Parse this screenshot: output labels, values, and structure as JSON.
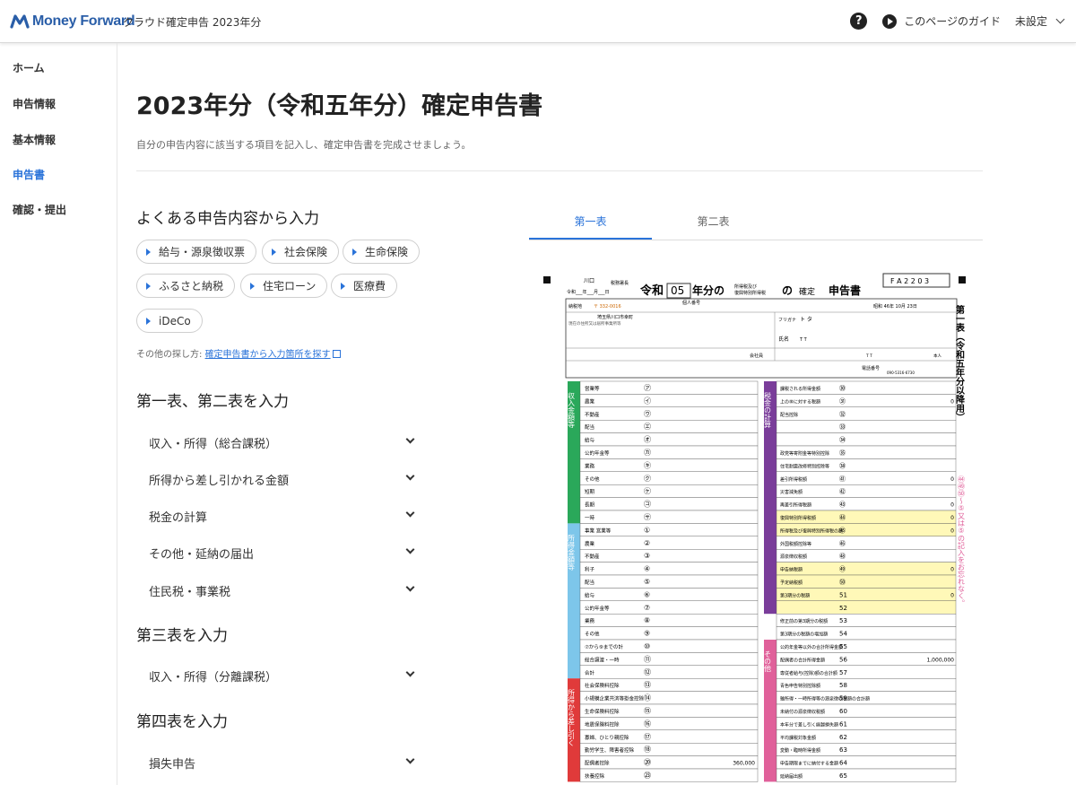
{
  "header": {
    "logo_text": "Money Forward",
    "app_name": "クラウド確定申告 2023年分",
    "help_icon_label": "?",
    "guide_label": "このページのガイド",
    "user_label": "未設定"
  },
  "sidebar": {
    "items": [
      {
        "label": "ホーム"
      },
      {
        "label": "申告情報"
      },
      {
        "label": "基本情報"
      },
      {
        "label": "申告書",
        "active": true
      },
      {
        "label": "確認・提出"
      }
    ]
  },
  "main": {
    "title": "2023年分（令和五年分）確定申告書",
    "subtitle": "自分の申告内容に該当する項目を記入し、確定申告書を完成させましょう。"
  },
  "common": {
    "title": "よくある申告内容から入力",
    "chips": [
      "給与・源泉徴収票",
      "社会保険",
      "生命保険",
      "ふるさと納税",
      "住宅ローン",
      "医療費",
      "iDeCo"
    ],
    "other_prefix": "その他の探し方: ",
    "other_link": "確定申告書から入力箇所を探す"
  },
  "sections": [
    {
      "title": "第一表、第二表を入力",
      "items": [
        "収入・所得（総合課税）",
        "所得から差し引かれる金額",
        "税金の計算",
        "その他・延納の届出",
        "住民税・事業税"
      ]
    },
    {
      "title": "第三表を入力",
      "items": [
        "収入・所得（分離課税）"
      ]
    },
    {
      "title": "第四表を入力",
      "items": [
        "損失申告"
      ]
    }
  ],
  "tabs": [
    {
      "label": "第一表",
      "active": true
    },
    {
      "label": "第二表",
      "active": false
    }
  ],
  "form": {
    "office": "川口",
    "office_suffix": "税務署長",
    "era_line": "令和___年___月___日",
    "head_reiwa": "令和",
    "year": "05",
    "head_mid": "年分の",
    "small1": "所得税及び",
    "small2": "復興特別所得税",
    "head_no": "の",
    "head_kakutei": "確定",
    "head_shinkoku": "申告書",
    "code": "F A 2 2 0 3",
    "postal_label": "納税地",
    "postal": "〒 332-0016",
    "address": "埼玉県川口市幸町",
    "furigana_label": "フリガナ",
    "furigana": "ト タ",
    "name_label": "氏名",
    "name": "T T",
    "birth_label": "生年月日",
    "birth": "昭和 46年 10月 23日",
    "individual_label": "個人番号",
    "company": "会社員",
    "phone_label": "電話番号",
    "phone": "090-5316-6730",
    "head_of_household": "T T",
    "relation": "本人",
    "dwelling": "現在の住所又は居所事業所等",
    "income_section": "収入金額等",
    "income_section2": "所得金額等",
    "deduction_section": "所得から差し引く",
    "tax_section": "税金の計算",
    "other_section": "その他",
    "side_title": "第一表（令和五年分以降用）",
    "side_note": "㊹㊾㊿～⑤又は⑤の記入をお忘れなく。",
    "left_rows": [
      {
        "label": "営業等",
        "mark": "㋐"
      },
      {
        "label": "農業",
        "mark": "㋑"
      },
      {
        "label": "不動産",
        "mark": "㋒"
      },
      {
        "label": "配当",
        "mark": "㋓"
      },
      {
        "label": "給与",
        "mark": "㋔"
      },
      {
        "label": "公的年金等",
        "mark": "㋕"
      },
      {
        "label": "業務",
        "mark": "㋖"
      },
      {
        "label": "その他",
        "mark": "㋗"
      },
      {
        "label": "短期",
        "mark": "㋘"
      },
      {
        "label": "長期",
        "mark": "㋙"
      },
      {
        "label": "一時",
        "mark": "㋚"
      },
      {
        "label": "事業 営業等",
        "mark": "①"
      },
      {
        "label": "農業",
        "mark": "②"
      },
      {
        "label": "不動産",
        "mark": "③"
      },
      {
        "label": "利子",
        "mark": "④"
      },
      {
        "label": "配当",
        "mark": "⑤"
      },
      {
        "label": "給与",
        "mark": "⑥"
      },
      {
        "label": "公的年金等",
        "mark": "⑦"
      },
      {
        "label": "業務",
        "mark": "⑧"
      },
      {
        "label": "その他",
        "mark": "⑨"
      },
      {
        "label": "⑦から⑨までの計",
        "mark": "⑩"
      },
      {
        "label": "総合譲渡・一時",
        "mark": "⑪"
      },
      {
        "label": "合計",
        "mark": "⑫"
      },
      {
        "label": "社会保険料控除",
        "mark": "⑬"
      },
      {
        "label": "小規模企業共済等掛金控除",
        "mark": "⑭"
      },
      {
        "label": "生命保険料控除",
        "mark": "⑮"
      },
      {
        "label": "地震保険料控除",
        "mark": "⑯"
      },
      {
        "label": "寡婦、ひとり親控除",
        "mark": "⑰"
      },
      {
        "label": "勤労学生、障害者控除",
        "mark": "⑱"
      },
      {
        "label": "配偶者控除",
        "mark": "⑳",
        "value": "360,000"
      },
      {
        "label": "扶養控除",
        "mark": "㉓"
      }
    ],
    "right_rows": [
      {
        "label": "課税される所得金額",
        "mark": "㉚"
      },
      {
        "label": "上の㉚に対する税額",
        "mark": "㉛",
        "value": "0"
      },
      {
        "label": "配当控除",
        "mark": "㉜"
      },
      {
        "label": "",
        "mark": "㉝"
      },
      {
        "label": "",
        "mark": "㉞"
      },
      {
        "label": "政党等寄附金等特別控除",
        "mark": "㉟"
      },
      {
        "label": "住宅耐震改修特別控除等",
        "mark": "㊳"
      },
      {
        "label": "差引所得税額",
        "mark": "㊶",
        "value": "0"
      },
      {
        "label": "災害減免額",
        "mark": "㊷"
      },
      {
        "label": "再差引所得税額",
        "mark": "㊸",
        "value": "0"
      },
      {
        "label": "復興特別所得税額",
        "mark": "㊹",
        "value": "0"
      },
      {
        "label": "所得税及び復興特別所得税の額",
        "mark": "㊺",
        "value": "0"
      },
      {
        "label": "外国税額控除等",
        "mark": "㊻"
      },
      {
        "label": "源泉徴収税額",
        "mark": "㊽"
      },
      {
        "label": "申告納税額",
        "mark": "㊾",
        "value": "0"
      },
      {
        "label": "予定納税額",
        "mark": "㊿"
      },
      {
        "label": "第3期分の税額",
        "mark": "51",
        "value": "0"
      },
      {
        "label": "",
        "mark": "52"
      },
      {
        "label": "修正前の第3期分の税額",
        "mark": "53"
      },
      {
        "label": "第3期分の税額の増加額",
        "mark": "54"
      },
      {
        "label": "公的年金等以外の合計所得金額",
        "mark": "55"
      },
      {
        "label": "配偶者の合計所得金額",
        "mark": "56",
        "value": "1,000,000"
      },
      {
        "label": "専従者給与(控除)額の合計額",
        "mark": "57"
      },
      {
        "label": "青色申告特別控除額",
        "mark": "58"
      },
      {
        "label": "雑所得・一時所得等の源泉徴収税額の合計額",
        "mark": "59"
      },
      {
        "label": "未納付の源泉徴収税額",
        "mark": "60"
      },
      {
        "label": "本年分で差し引く繰越損失額",
        "mark": "61"
      },
      {
        "label": "平均課税対象金額",
        "mark": "62"
      },
      {
        "label": "変動・臨時所得金額",
        "mark": "63"
      },
      {
        "label": "申告期限までに納付する金額",
        "mark": "64"
      },
      {
        "label": "延納届出額",
        "mark": "65"
      }
    ]
  },
  "colors": {
    "accent": "#2a73d9",
    "brand": "#2a5ea8",
    "green": "#2aa85a",
    "cyan": "#7dc6ea",
    "red": "#e03a3a",
    "purple": "#7a3d9a",
    "pink": "#e0609a",
    "lime": "#7cc850",
    "form_pink": "#ffe6ef",
    "form_yellow": "#fff8b8"
  }
}
